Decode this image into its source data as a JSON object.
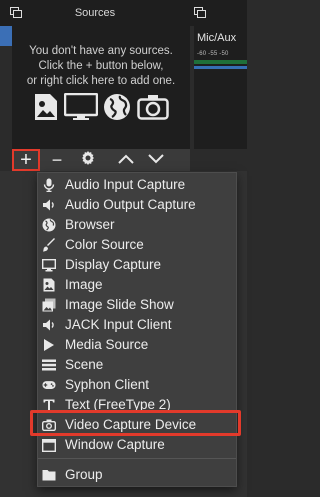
{
  "sources_panel": {
    "title": "Sources",
    "empty_line1": "You don't have any sources.",
    "empty_line2": "Click the + button below,",
    "empty_line3": "or right click here to add one.",
    "empty_icons": [
      "image-icon",
      "display-icon",
      "globe-icon",
      "camera-icon"
    ]
  },
  "mixer": {
    "label": "Mic/Aux",
    "ticks": "-60  -55  -50"
  },
  "toolbar": {
    "add": "+",
    "remove": "−",
    "settings": "gear-icon",
    "move_up": "chevron-up-icon",
    "move_down": "chevron-down-icon"
  },
  "menu": {
    "items": [
      {
        "label": "Audio Input Capture",
        "icon": "microphone-icon"
      },
      {
        "label": "Audio Output Capture",
        "icon": "speaker-icon"
      },
      {
        "label": "Browser",
        "icon": "globe-icon"
      },
      {
        "label": "Color Source",
        "icon": "paint-brush-icon"
      },
      {
        "label": "Display Capture",
        "icon": "display-icon"
      },
      {
        "label": "Image",
        "icon": "image-icon"
      },
      {
        "label": "Image Slide Show",
        "icon": "slideshow-icon"
      },
      {
        "label": "JACK Input Client",
        "icon": "speaker-icon"
      },
      {
        "label": "Media Source",
        "icon": "play-icon"
      },
      {
        "label": "Scene",
        "icon": "list-icon"
      },
      {
        "label": "Syphon Client",
        "icon": "gamepad-icon"
      },
      {
        "label": "Text (FreeType 2)",
        "icon": "text-icon"
      },
      {
        "label": "Video Capture Device",
        "icon": "camera-icon"
      },
      {
        "label": "Window Capture",
        "icon": "window-icon"
      }
    ],
    "group": {
      "label": "Group",
      "icon": "folder-icon"
    }
  },
  "colors": {
    "highlight": "#e23a2b",
    "panel": "#1e1e1e",
    "menu_bg": "#3f3f3f",
    "meter_green": "#1f6f3a",
    "accent_blue": "#3b6fb6"
  }
}
